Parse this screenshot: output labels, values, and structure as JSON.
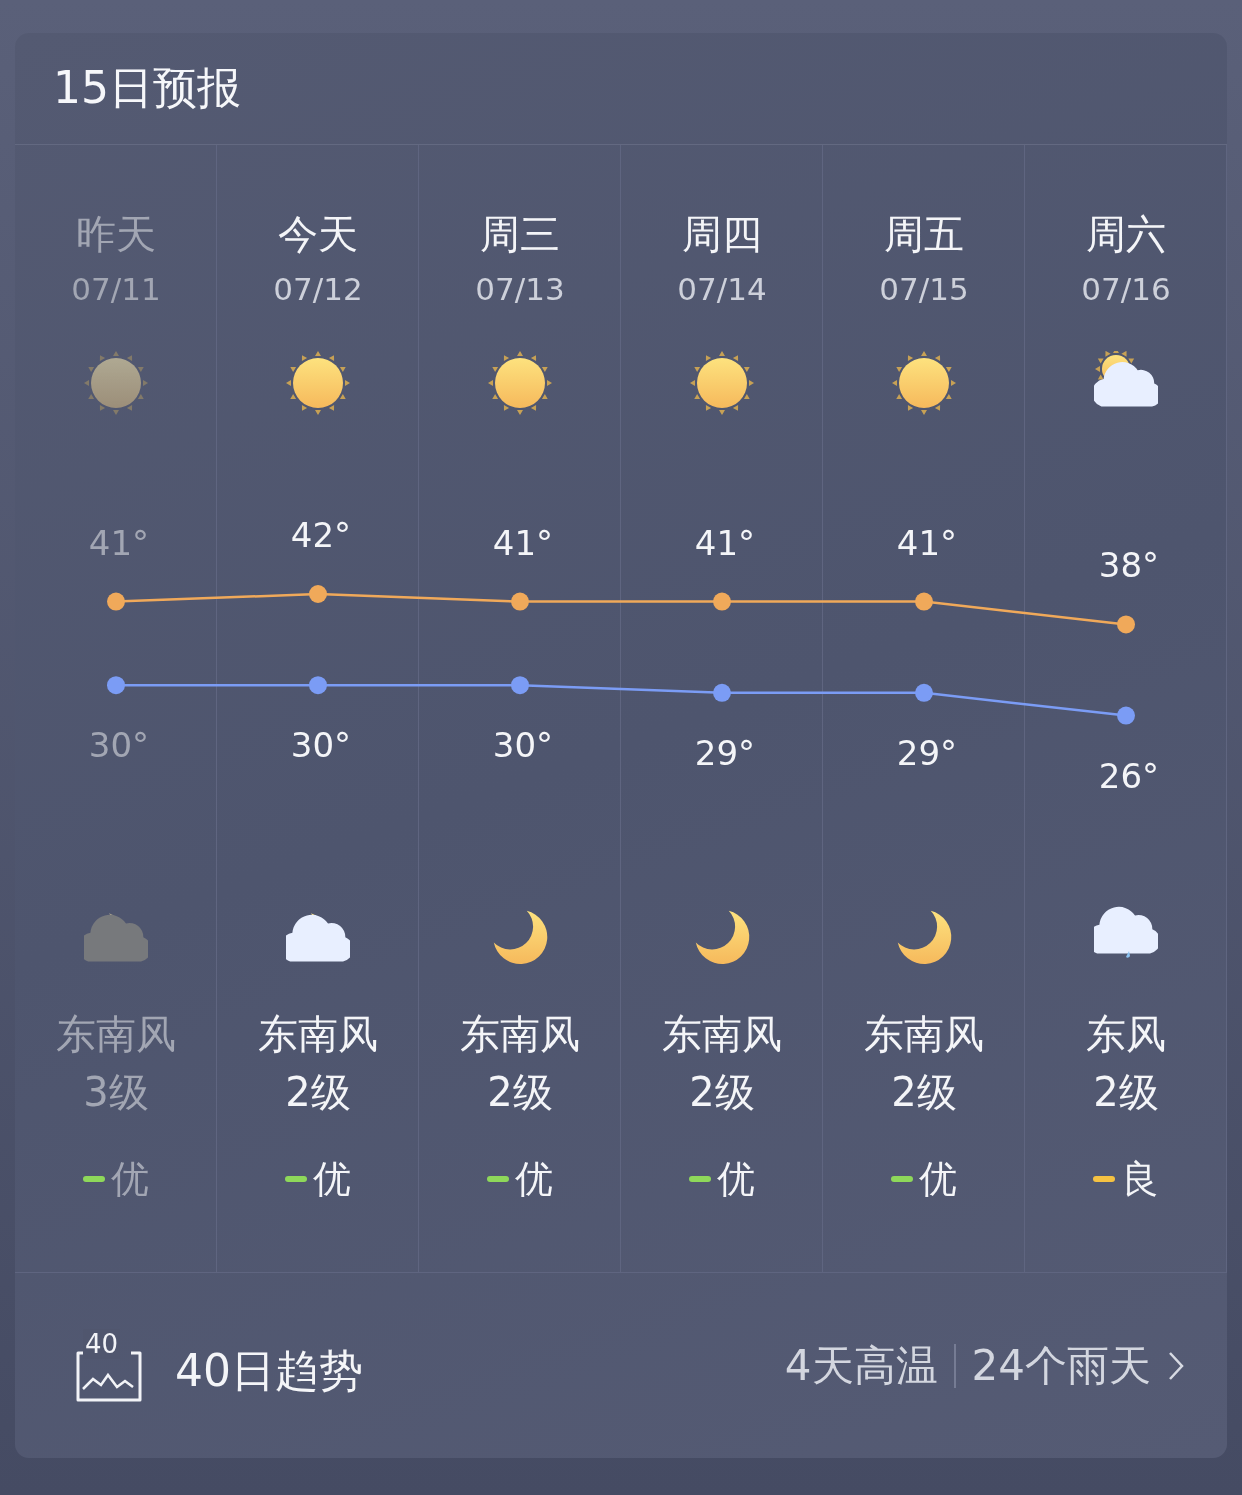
{
  "header": {
    "title": "15日预报"
  },
  "days": [
    {
      "day": "昨天",
      "date": "07/11",
      "past": true,
      "day_icon": {
        "kind": "sun"
      },
      "night_icon": {
        "kind": "moon_cloud"
      },
      "wind": "东南风",
      "wind_level": "3级",
      "air": {
        "label": "优",
        "color": "#8ed85a"
      }
    },
    {
      "day": "今天",
      "date": "07/12",
      "past": false,
      "day_icon": {
        "kind": "sun"
      },
      "night_icon": {
        "kind": "moon_cloud"
      },
      "wind": "东南风",
      "wind_level": "2级",
      "air": {
        "label": "优",
        "color": "#8ed85a"
      }
    },
    {
      "day": "周三",
      "date": "07/13",
      "past": false,
      "day_icon": {
        "kind": "sun"
      },
      "night_icon": {
        "kind": "moon"
      },
      "wind": "东南风",
      "wind_level": "2级",
      "air": {
        "label": "优",
        "color": "#8ed85a"
      }
    },
    {
      "day": "周四",
      "date": "07/14",
      "past": false,
      "day_icon": {
        "kind": "sun"
      },
      "night_icon": {
        "kind": "moon"
      },
      "wind": "东南风",
      "wind_level": "2级",
      "air": {
        "label": "优",
        "color": "#8ed85a"
      }
    },
    {
      "day": "周五",
      "date": "07/15",
      "past": false,
      "day_icon": {
        "kind": "sun"
      },
      "night_icon": {
        "kind": "moon"
      },
      "wind": "东南风",
      "wind_level": "2级",
      "air": {
        "label": "优",
        "color": "#8ed85a"
      }
    },
    {
      "day": "周六",
      "date": "07/16",
      "past": false,
      "day_icon": {
        "kind": "sun_cloud"
      },
      "night_icon": {
        "kind": "rain_cloud"
      },
      "wind": "东风",
      "wind_level": "2级",
      "air": {
        "label": "良",
        "color": "#f5c242"
      }
    }
  ],
  "chart_data": {
    "type": "line",
    "series": [
      {
        "color": "#f0a95a",
        "marker": true,
        "values": [
          41,
          42,
          41,
          41,
          41,
          38
        ],
        "value_labels": [
          "41°",
          "42°",
          "41°",
          "41°",
          "41°",
          "38°"
        ]
      },
      {
        "color": "#7b9cf5",
        "marker": true,
        "values": [
          30,
          30,
          30,
          29,
          29,
          26
        ],
        "value_labels": [
          "30°",
          "30°",
          "30°",
          "29°",
          "29°",
          "26°"
        ]
      }
    ]
  },
  "trend": {
    "icon_text": "40",
    "label": "40日趋势",
    "hot_days": "4天高温",
    "rain_days": "24个雨天"
  }
}
